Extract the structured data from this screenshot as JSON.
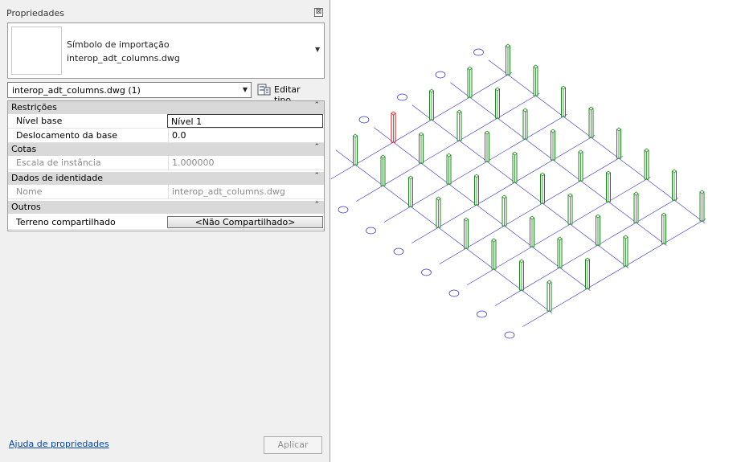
{
  "panel": {
    "title": "Propriedades",
    "close_glyph": "⊠",
    "type_selector": {
      "family": "Símbolo de importação",
      "type": "interop_adt_columns.dwg",
      "dropdown_icon": "triangle-down-icon"
    },
    "instance_filter": {
      "value": "interop_adt_columns.dwg (1)"
    },
    "edit_type_label": "Editar tipo",
    "collapse_glyph": "⌃"
  },
  "properties": {
    "restricoes": {
      "label": "Restrições",
      "nivel_base": {
        "label": "Nível base",
        "value": "Nível 1"
      },
      "deslocamento": {
        "label": "Deslocamento da base",
        "value": "0.0"
      }
    },
    "cotas": {
      "label": "Cotas",
      "escala": {
        "label": "Escala de instância",
        "value": "1.000000"
      }
    },
    "identidade": {
      "label": "Dados de identidade",
      "nome": {
        "label": "Nome",
        "value": "interop_adt_columns.dwg"
      }
    },
    "outros": {
      "label": "Outros",
      "terreno": {
        "label": "Terreno compartilhado",
        "value": "<Não Compartilhado>"
      }
    }
  },
  "footer": {
    "help_link": "Ajuda de propriedades",
    "apply_label": "Aplicar"
  },
  "viewport": {
    "grid_rows": 5,
    "grid_cols": 8,
    "grid_color": "#3030d0",
    "column_color": "#1a8a1a",
    "selected_column_color": "#e01010",
    "selected_column": [
      0,
      1
    ]
  }
}
